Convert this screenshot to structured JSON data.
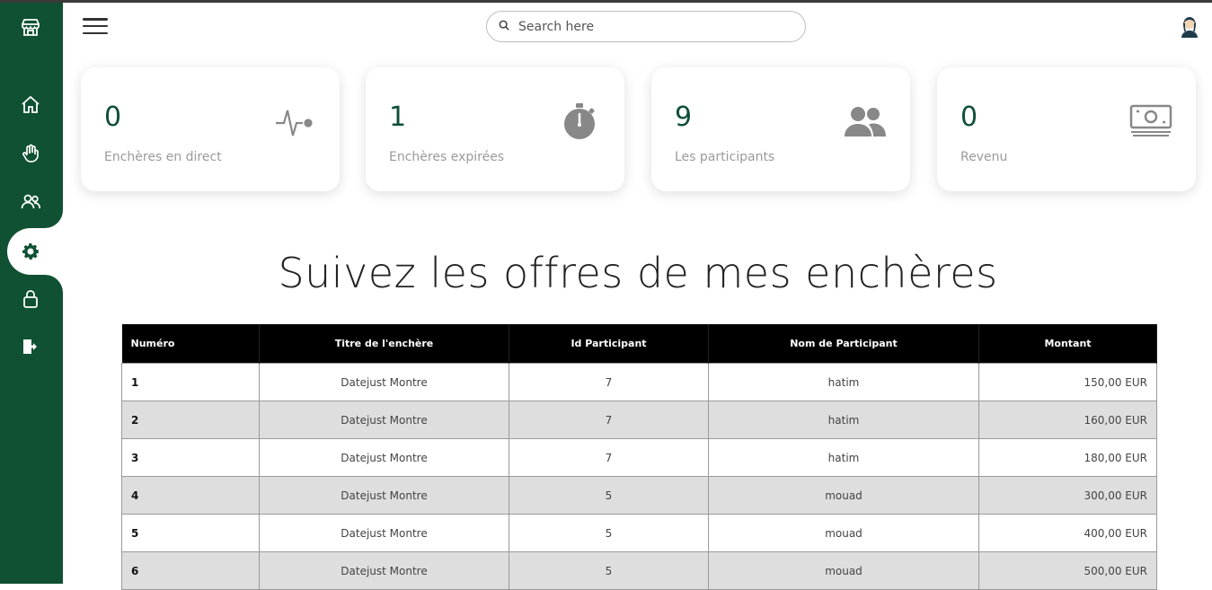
{
  "search": {
    "placeholder": "Search here"
  },
  "stats": [
    {
      "value": "0",
      "label": "Enchères en direct",
      "icon": "pulse-icon"
    },
    {
      "value": "1",
      "label": "Enchères expirées",
      "icon": "stopwatch-icon"
    },
    {
      "value": "9",
      "label": "Les participants",
      "icon": "users-icon"
    },
    {
      "value": "0",
      "label": "Revenu",
      "icon": "money-icon"
    }
  ],
  "page": {
    "title": "Suivez les offres de mes enchères"
  },
  "table": {
    "headers": [
      "Numéro",
      "Titre de l'enchère",
      "Id Participant",
      "Nom de Participant",
      "Montant"
    ],
    "rows": [
      [
        "1",
        "Datejust Montre",
        "7",
        "hatim",
        "150,00 EUR"
      ],
      [
        "2",
        "Datejust Montre",
        "7",
        "hatim",
        "160,00 EUR"
      ],
      [
        "3",
        "Datejust Montre",
        "7",
        "hatim",
        "180,00 EUR"
      ],
      [
        "4",
        "Datejust Montre",
        "5",
        "mouad",
        "300,00 EUR"
      ],
      [
        "5",
        "Datejust Montre",
        "5",
        "mouad",
        "400,00 EUR"
      ],
      [
        "6",
        "Datejust Montre",
        "5",
        "mouad",
        "500,00 EUR"
      ]
    ]
  },
  "colors": {
    "sidebar": "#0f5132",
    "accent_text": "#0f4f3a",
    "table_header": "#000000"
  }
}
